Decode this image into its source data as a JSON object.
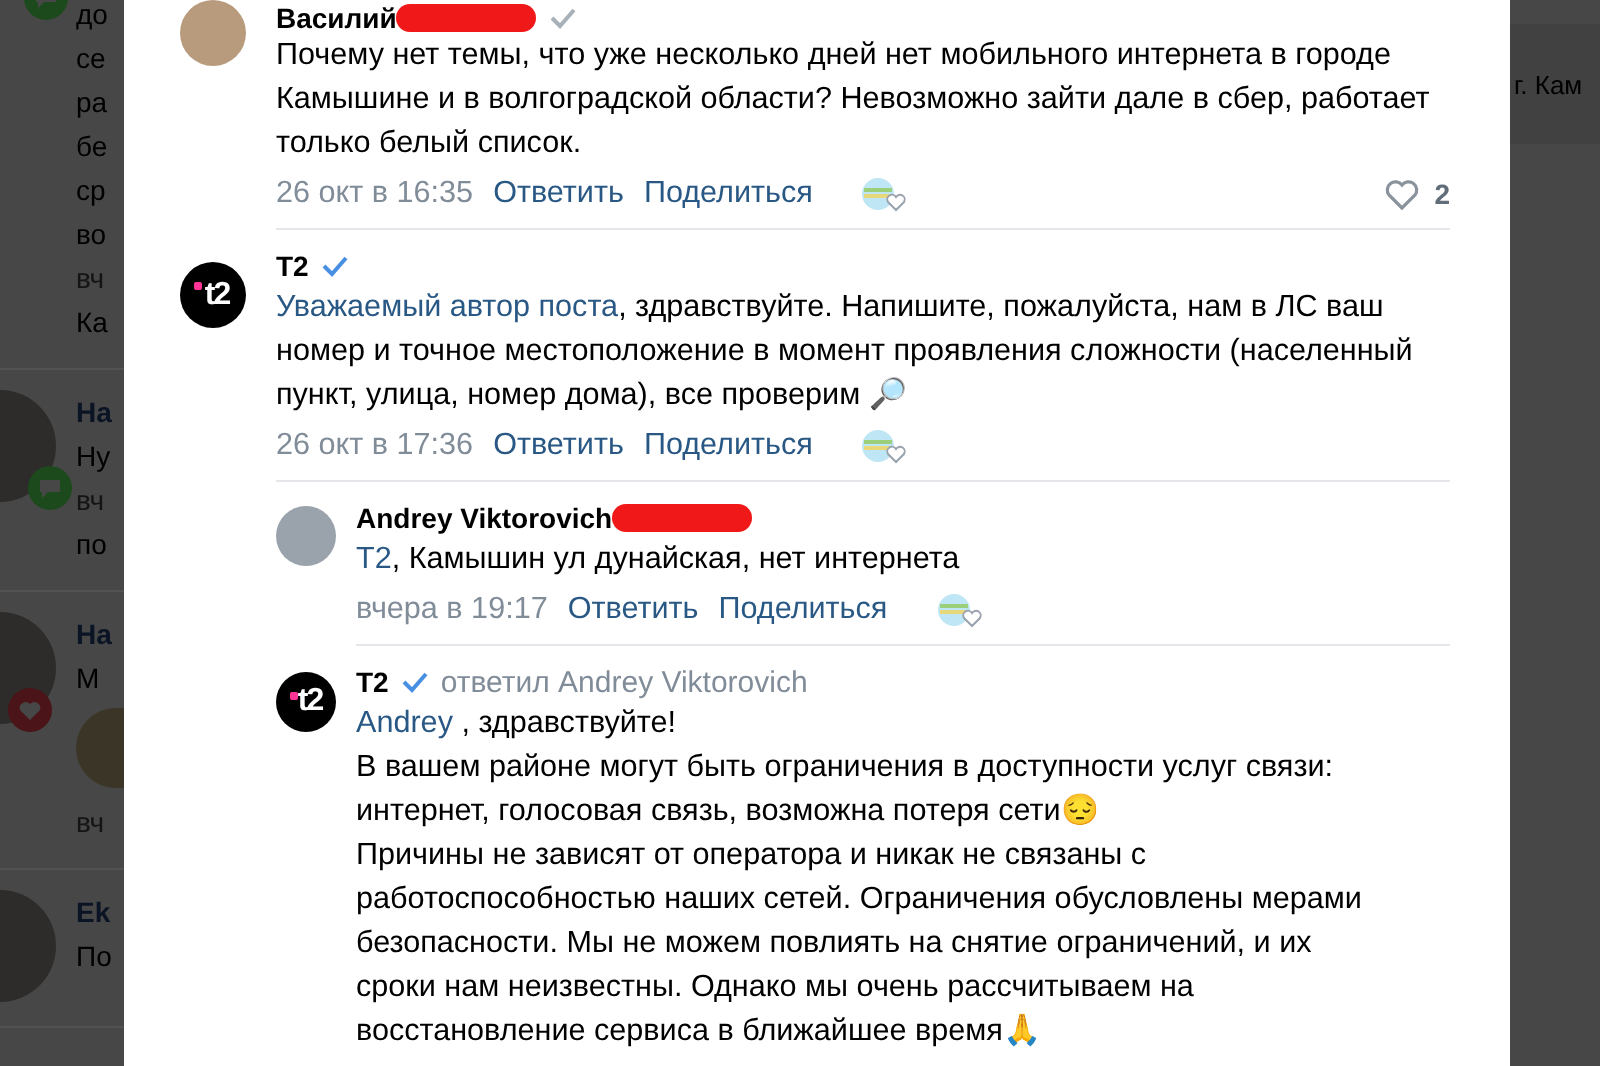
{
  "background_feed": {
    "items": [
      {
        "badge": {
          "kind": "comment"
        },
        "avatar": false,
        "lines": [
          {
            "kind": "text",
            "text": "до"
          },
          {
            "kind": "text",
            "text": "се"
          },
          {
            "kind": "text",
            "text": "ра"
          },
          {
            "kind": "text",
            "text": "бе"
          },
          {
            "kind": "text",
            "text": "ср"
          },
          {
            "kind": "text",
            "text": "во"
          },
          {
            "kind": "meta",
            "text": "вч"
          },
          {
            "kind": "text",
            "text": "Ка"
          }
        ]
      },
      {
        "badge": {
          "kind": "comment"
        },
        "avatar": true,
        "lines": [
          {
            "kind": "author",
            "text": "На"
          },
          {
            "kind": "text",
            "text": "Ну"
          },
          {
            "kind": "meta",
            "text": "вч"
          },
          {
            "kind": "text",
            "text": "по"
          }
        ]
      },
      {
        "badge": {
          "kind": "like"
        },
        "avatar": true,
        "lines": [
          {
            "kind": "author",
            "text": "На"
          },
          {
            "kind": "text",
            "text": "М"
          },
          {
            "kind": "photo"
          },
          {
            "kind": "meta",
            "text": "вч"
          }
        ]
      },
      {
        "avatar": true,
        "lines": [
          {
            "kind": "author",
            "text": "Ek"
          },
          {
            "kind": "text",
            "text": "По"
          }
        ]
      }
    ]
  },
  "background_right": {
    "text": "г. Кам"
  },
  "comments": [
    {
      "author": "Василий",
      "redacted": true,
      "check": {
        "kind": "muted"
      },
      "avatar": {
        "kind": "photo"
      },
      "paragraphs": [
        [
          {
            "kind": "text",
            "text": "Почему нет темы, что уже несколько дней нет мобильного интернета в городе Камышине и в волгоградской области? Невозможно зайти дале в сбер, работает только белый список."
          }
        ]
      ],
      "date": "26 окт в 16:35",
      "reply": "Ответить",
      "share": "Поделиться",
      "likes": "2"
    },
    {
      "author": "T2",
      "redacted": false,
      "check": {
        "kind": "verified"
      },
      "avatar": {
        "kind": "logo",
        "text": "t2"
      },
      "paragraphs": [
        [
          {
            "kind": "link",
            "text": "Уважаемый автор поста"
          },
          {
            "kind": "text",
            "text": ", здравствуйте. Напишите, пожалуйста, нам в ЛС ваш номер и точное местоположение в момент проявления сложности (населенный пункт, улица, номер дома), все проверим 🔎"
          }
        ]
      ],
      "date": "26 окт в 17:36",
      "reply": "Ответить",
      "share": "Поделиться",
      "children": [
        {
          "author": "Andrey Viktorovich",
          "redacted": true,
          "avatar": {
            "kind": "photo"
          },
          "paragraphs": [
            [
              {
                "kind": "link",
                "text": "T2"
              },
              {
                "kind": "text",
                "text": ", Камышин ул дунайская, нет интернета"
              }
            ]
          ],
          "date": "вчера в 19:17",
          "reply": "Ответить",
          "share": "Поделиться"
        },
        {
          "author": "T2",
          "redacted": false,
          "check": {
            "kind": "verified"
          },
          "reply_to": "ответил Andrey Viktorovich",
          "avatar": {
            "kind": "logo",
            "text": "t2"
          },
          "paragraphs": [
            [
              {
                "kind": "link",
                "text": "Andrey"
              },
              {
                "kind": "text",
                "text": " , здравствуйте!"
              }
            ],
            [
              {
                "kind": "text",
                "text": "В вашем районе могут быть ограничения в доступности услуг связи: интернет, голосовая связь, возможна потеря сети😔"
              }
            ],
            [
              {
                "kind": "text",
                "text": "Причины не зависят от оператора и никак не связаны с работоспособностью наших сетей. Ограничения обусловлены мерами безопасности. Мы не можем повлиять на снятие ограничений, и их сроки нам неизвестны. Однако мы очень рассчитываем на восстановление сервиса в ближайшее время🙏"
              }
            ]
          ]
        }
      ]
    }
  ]
}
